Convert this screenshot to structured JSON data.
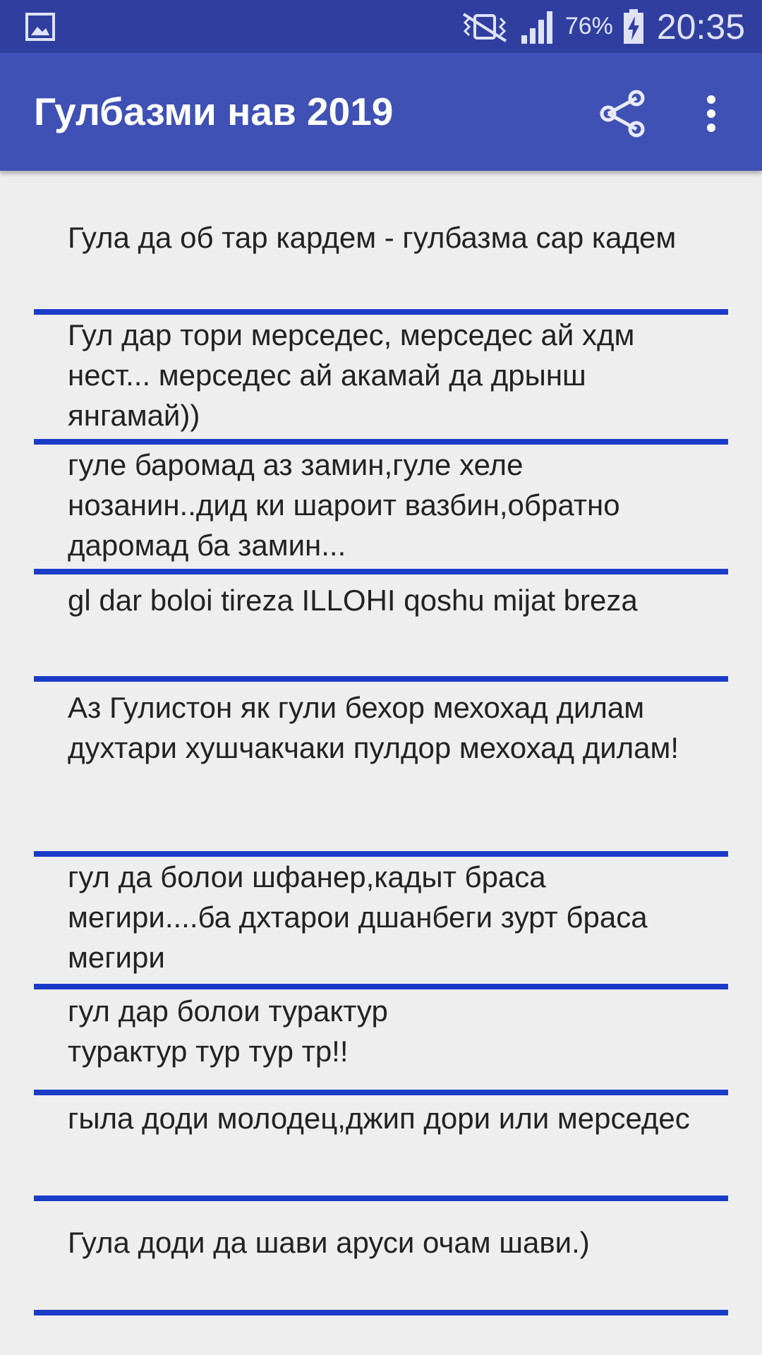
{
  "status_bar": {
    "gallery_icon": "image-icon",
    "mute_icon": "vibrate-mute-icon",
    "signal_icon": "signal-icon",
    "battery_percent": "76%",
    "battery_icon": "battery-charging-icon",
    "time": "20:35"
  },
  "app_bar": {
    "title": "Гулбазми нав 2019",
    "share_icon": "share-icon",
    "more_icon": "more-vert-icon"
  },
  "list": {
    "items": [
      {
        "text": "Гула да об тар кардем - гулбазма сар кадем"
      },
      {
        "text": "Гул дар тори мерседес, мерседес ай хдм нест... мерседес ай акамай да дрынш янгамай))"
      },
      {
        "text": "гуле баромад аз замин,гуле хеле нозанин..дид ки шароит вазбин,обратно даромад ба замин..."
      },
      {
        "text": "gl dar boloi tireza ILLOHI qoshu mijat breza"
      },
      {
        "text": "Аз Гулистон як гули бехор мехохад дилам\nдухтари хушчакчаки пулдор мехохад дилам!"
      },
      {
        "text": "гул да болои шфанер,кадыт браса мегири....ба дхтарои дшанбеги зурт браса мегири"
      },
      {
        "text": "гул дар болои турактур\nтурактур тур тур тр!!"
      },
      {
        "text": "гыла доди молодец,джип дори или мерседес"
      },
      {
        "text": "Гула доди да шави аруси очам шави.)"
      }
    ]
  }
}
